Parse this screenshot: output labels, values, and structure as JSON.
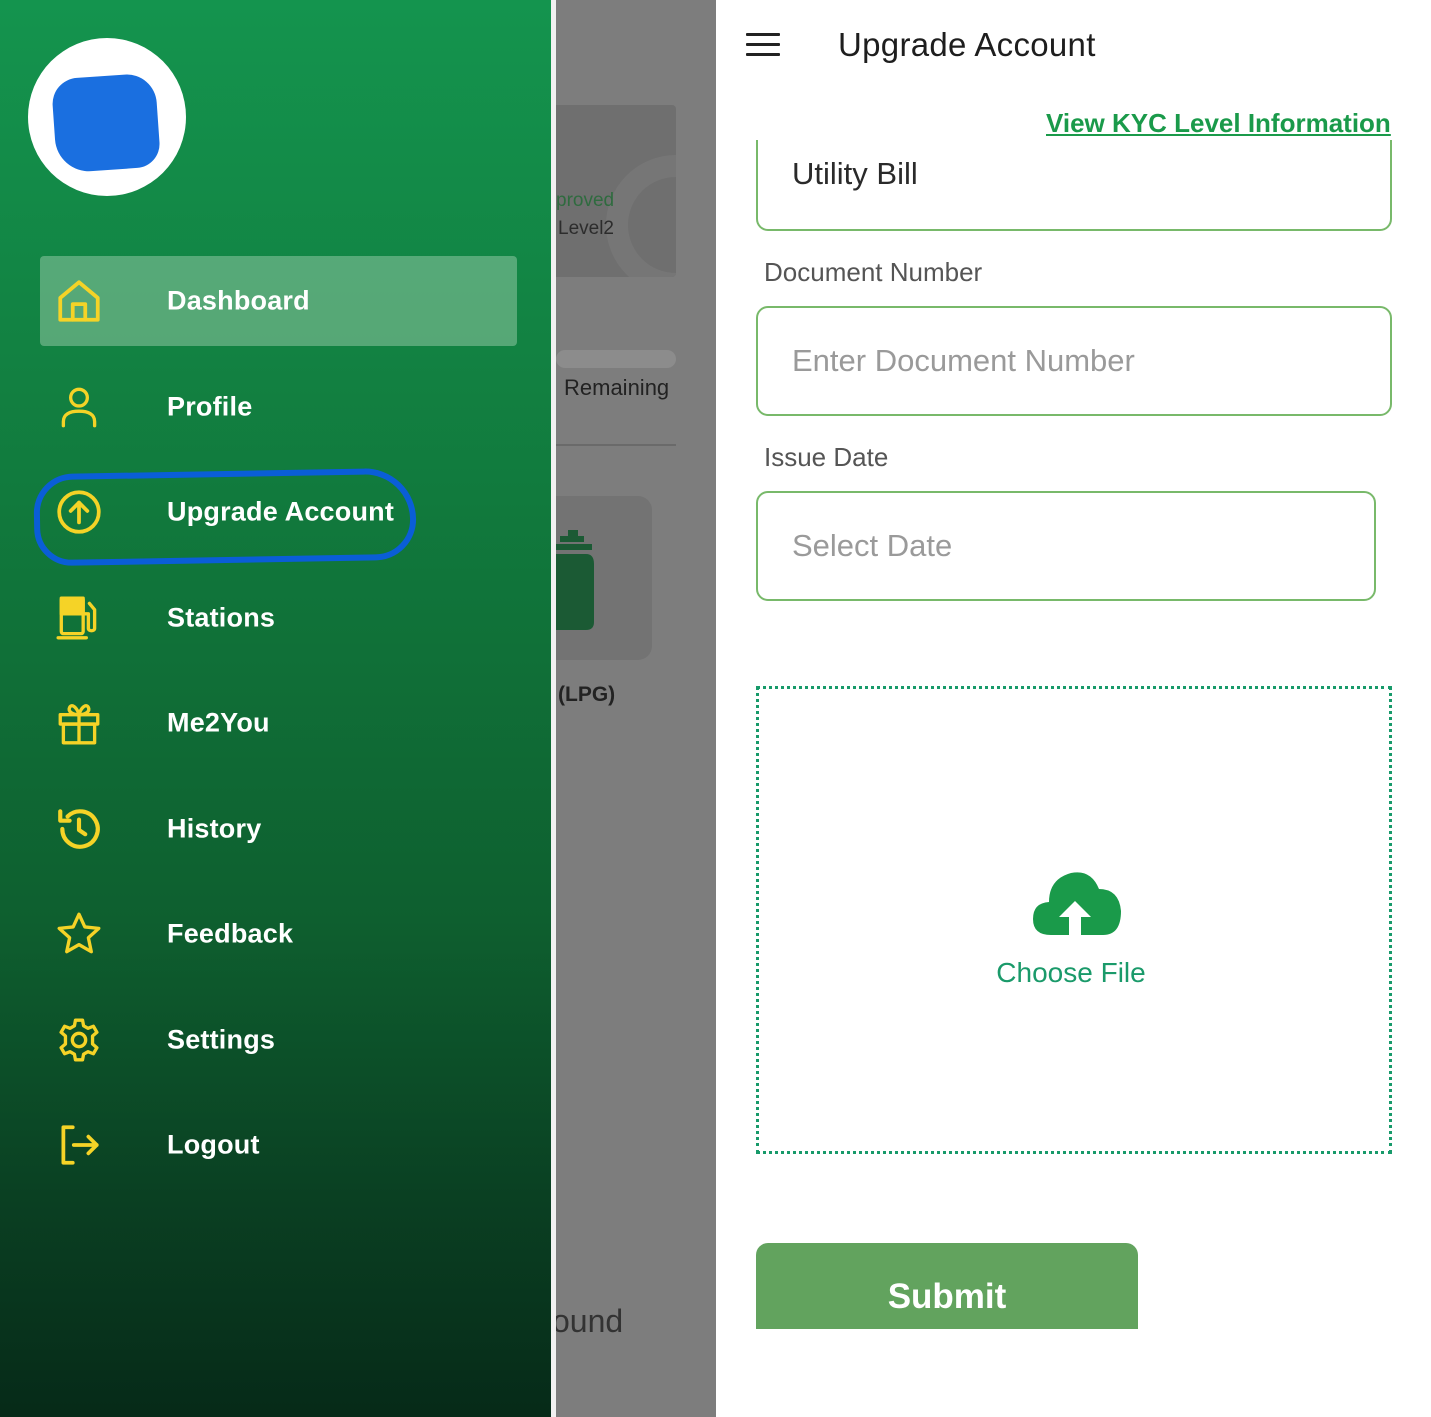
{
  "drawer": {
    "items": [
      {
        "label": "Dashboard",
        "icon": "home-icon",
        "active": true
      },
      {
        "label": "Profile",
        "icon": "user-icon",
        "active": false
      },
      {
        "label": "Upgrade Account",
        "icon": "arrow-up-circle-icon",
        "active": false,
        "annotated": true
      },
      {
        "label": "Stations",
        "icon": "fuel-pump-icon",
        "active": false
      },
      {
        "label": "Me2You",
        "icon": "gift-icon",
        "active": false
      },
      {
        "label": "History",
        "icon": "history-icon",
        "active": false
      },
      {
        "label": "Feedback",
        "icon": "star-icon",
        "active": false
      },
      {
        "label": "Settings",
        "icon": "gear-icon",
        "active": false
      },
      {
        "label": "Logout",
        "icon": "logout-icon",
        "active": false
      }
    ],
    "icon_color": "#f5d327",
    "gradient_top": "#14944e",
    "gradient_bottom": "#062a18"
  },
  "background": {
    "status_text": "proved",
    "level_text": "Level2",
    "remaining_text": "Remaining",
    "product_text": "(LPG)",
    "bottom_text": "ound"
  },
  "header": {
    "title": "Upgrade Account"
  },
  "form": {
    "kyc_link": "View KYC Level Information",
    "document_type_value": "Utility Bill",
    "document_number_label": "Document Number",
    "document_number_placeholder": "Enter Document Number",
    "issue_date_label": "Issue Date",
    "issue_date_placeholder": "Select Date",
    "upload_label": "Choose File",
    "submit_label": "Submit"
  },
  "colors": {
    "accent_green": "#1a9a4a",
    "field_border": "#78b96a",
    "submit_bg": "#62a35e",
    "annotation_blue": "#0a5ed7"
  }
}
